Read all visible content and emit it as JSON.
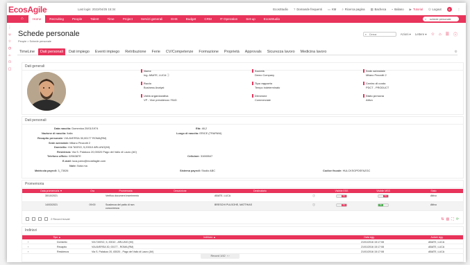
{
  "app": {
    "logo": "EcosAgile",
    "last_login": "Last login: 2022/04/25 15:34",
    "top_links": [
      "EcosStudio",
      "Domande frequenti",
      "KM",
      "Ricerca pagina",
      "Bacheca",
      "Italiano",
      "Tutorial",
      "Logout"
    ],
    "badge": "8"
  },
  "nav": {
    "items": [
      "Home",
      "Recruiting",
      "People",
      "Talent",
      "Time",
      "Project",
      "Servizi generali",
      "EHS",
      "Budget",
      "CRM",
      "IT Operation",
      "Set-up",
      "EcosStudio"
    ],
    "active": 0,
    "search_value": "schede personale"
  },
  "header": {
    "title": "Schede personale",
    "breadcrumb": "People > Schede personale",
    "search_placeholder": "Cerca",
    "azioni": "Azioni",
    "lettere": "Lettere"
  },
  "tabs": [
    "TimeLine",
    "Dati personali",
    "Dati impiego",
    "Eventi impiego",
    "Retribuzione",
    "Ferie",
    "CV/Competenze",
    "Formazione",
    "Proprietà",
    "Approvals",
    "Sicurezza lavoro",
    "Medicina lavoro"
  ],
  "active_tab": 1,
  "dati_generali": {
    "title": "Dati generali",
    "nome_lbl": "Nome",
    "nome": "Ing. ABATE, LUCA",
    "societa_lbl": "Società",
    "societa": "Demo Company",
    "sede_lbl": "Sede aziendale",
    "sede": "Milano Pezzotti 2",
    "ruolo_lbl": "Ruolo",
    "ruolo": "Business Analyst",
    "tipo_lbl": "Tipo rapporto",
    "tipo": "Tempo indeterminato",
    "centro_lbl": "Centro di costo",
    "centro": "PDCT - PRODUCT",
    "unita_lbl": "Unità organizzativa",
    "unita": "VP - Vice presidenza / R&D",
    "direzione_lbl": "Direzione",
    "direzione": "Commerciale",
    "stato_lbl": "Stato persona",
    "stato": "Attivo"
  },
  "dati_personali": {
    "title": "Dati personali",
    "rows": [
      {
        "label": "Data nascita:",
        "value": "Domenica 20/01/1974"
      },
      {
        "label": "Nazione di nascita:",
        "value": "Italia"
      },
      {
        "label": "Recapito personale:",
        "value": "VIA AVERSA 30,00177 ROMA(RM)"
      },
      {
        "label": "Sede aziendale:",
        "value": "Milano Pezzotti 2"
      },
      {
        "label": "Domicilio:",
        "value": "VIA TASSO, 5,20010 ARLUNO(MI)"
      },
      {
        "label": "Residenza:",
        "value": "Via S. Palaluco 20,00020 Pago del Vallo di Lauro (AV)"
      },
      {
        "label": "Telefono ufficio:",
        "value": "0256387E"
      },
      {
        "label": "E-mail:",
        "value": "luca.parro@ecosflagile.com"
      },
      {
        "label": "Note:",
        "value": "Nota ma"
      },
      {
        "label": "Matricola payroll:",
        "value": "3_73026"
      }
    ],
    "eta_lbl": "Età:",
    "eta": "48,2",
    "luogo_lbl": "Luogo di nascita:",
    "luogo": "ERICE (TRAPANI)",
    "cellulare_lbl": "Cellulare:",
    "cellulare": "31065547",
    "sistema_lbl": "Sistema payroll:",
    "sistema": "Studio ABC",
    "cf_lbl": "Codice fiscale:",
    "cf": "HULCKSOPDSFAZGC"
  },
  "promemoria": {
    "title": "Promemoria",
    "headers": [
      "Data promemoria ▼",
      "Ora",
      "Promemoria",
      "Descrizione",
      "Destinatario",
      "",
      "Visibile ESS",
      "Visibile MSS",
      "Stato"
    ],
    "rows": [
      {
        "data": "30/10/2021",
        "ora": "",
        "prom": "Verifica document inserimento",
        "desc": "",
        "dest": "ABATE, LUCA",
        "ess": "No",
        "mss": "No",
        "stato": "Attivo"
      },
      {
        "data": "14/03/2021",
        "ora": "09:00",
        "prom": "Scadenza del patto di non concorrenza",
        "desc": "",
        "dest": "BRESCHI PULSOHE, MATTHIAS",
        "ess": "No",
        "mss": "Si",
        "stato": "Attivo"
      }
    ],
    "record_count": "2 Record trovati"
  },
  "indirizzi": {
    "title": "Indirizzi",
    "headers": [
      "Tipo ▲",
      "Indirizzo ▲",
      "Data agg.",
      "Autore agg."
    ],
    "rows": [
      {
        "tipo": "Domicilio",
        "ind": "VIA TASSO, 5, 20010 - ARLUNO (MI)",
        "data": "21/01/2016 15:17:08",
        "autore": "ABATE, LUCA"
      },
      {
        "tipo": "Recapito",
        "ind": "VIA AVERSA 30, 00177 - ROMA (RM)",
        "data": "21/01/2016 15:17:08",
        "autore": "ABATE, LUCA"
      },
      {
        "tipo": "Residenza",
        "ind": "Via S. Palaluco 20, 83020 - Pago del Vallo di Lauro (AV)",
        "data": "21/01/2016 15:17:08",
        "autore": "ABATE, LUCA"
      }
    ],
    "pager": "Record 1/42"
  }
}
